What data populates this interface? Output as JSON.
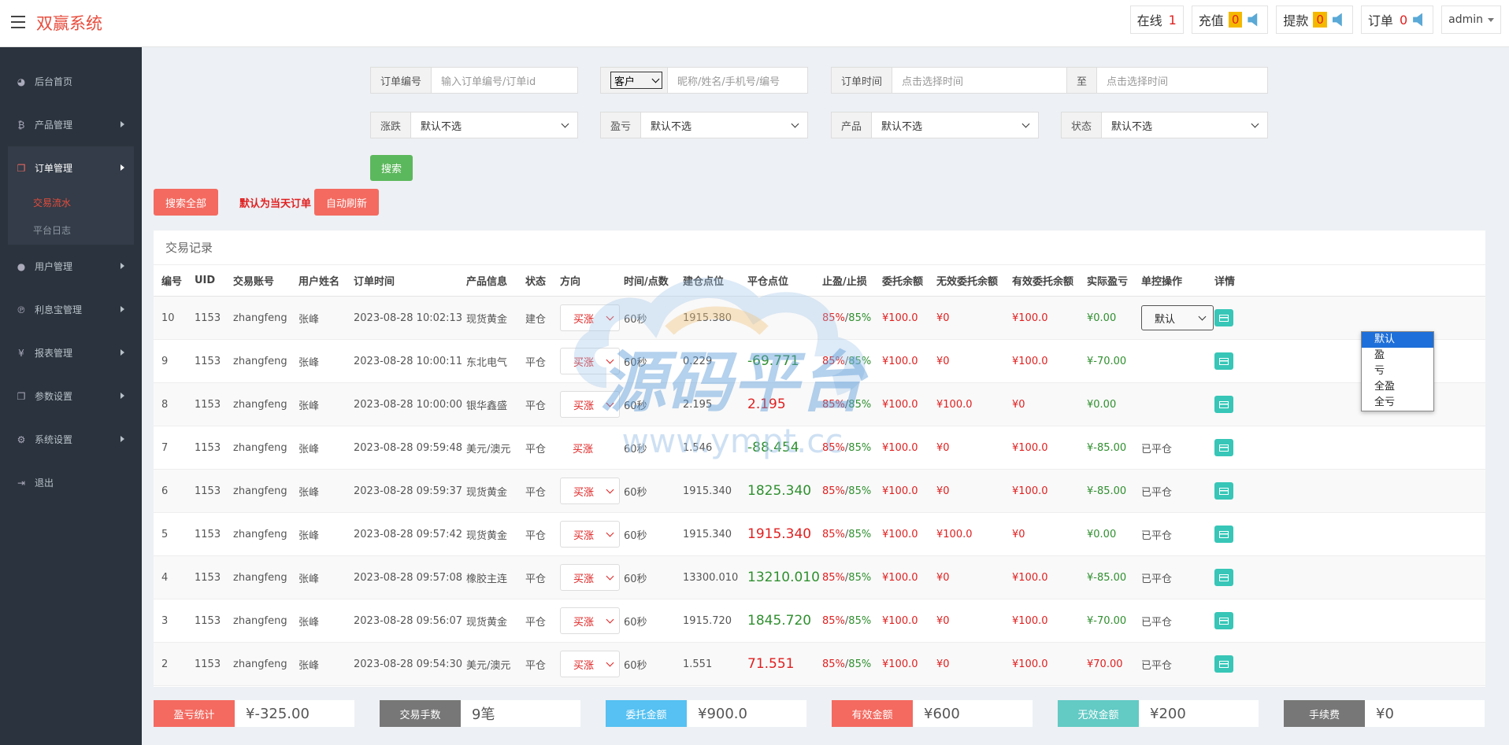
{
  "app": {
    "title": "双赢系统"
  },
  "topbar": {
    "online_label": "在线",
    "online_count": "1",
    "recharge_label": "充值",
    "recharge_count": "0",
    "withdraw_label": "提款",
    "withdraw_count": "0",
    "order_label": "订单",
    "order_count": "0",
    "user": "admin"
  },
  "sidebar": {
    "items": [
      {
        "label": "后台首页",
        "icon": "dashboard-icon"
      },
      {
        "label": "产品管理",
        "icon": "bitcoin-icon"
      },
      {
        "label": "订单管理",
        "icon": "copy-icon"
      },
      {
        "label": "用户管理",
        "icon": "user-icon"
      },
      {
        "label": "利息宝管理",
        "icon": "pinterest-icon"
      },
      {
        "label": "报表管理",
        "icon": "yen-icon"
      },
      {
        "label": "参数设置",
        "icon": "copy-icon"
      },
      {
        "label": "系统设置",
        "icon": "cogs-icon"
      },
      {
        "label": "退出",
        "icon": "sign-out-icon"
      }
    ],
    "sub": [
      {
        "label": "交易流水",
        "active": true
      },
      {
        "label": "平台日志",
        "active": false
      }
    ]
  },
  "filters": {
    "order_no_label": "订单编号",
    "order_no_placeholder": "输入订单编号/订单id",
    "client_select": "客户",
    "client_placeholder": "昵称/姓名/手机号/编号",
    "time_label": "订单时间",
    "time_placeholder": "点击选择时间",
    "to_label": "至",
    "time_placeholder2": "点击选择时间",
    "rise_label": "涨跌",
    "rise_value": "默认不选",
    "pl_label": "盈亏",
    "pl_value": "默认不选",
    "product_label": "产品",
    "product_value": "默认不选",
    "status_label": "状态",
    "status_value": "默认不选",
    "search_btn": "搜索"
  },
  "actions": {
    "search_all": "搜索全部",
    "note": "默认为当天订单",
    "auto_refresh": "自动刷新"
  },
  "table": {
    "title": "交易记录",
    "headers": [
      "编号",
      "UID",
      "交易账号",
      "用户姓名",
      "订单时间",
      "产品信息",
      "状态",
      "方向",
      "时间/点数",
      "建仓点位",
      "平仓点位",
      "止盈/止损",
      "委托余额",
      "无效委托余额",
      "有效委托余额",
      "实际盈亏",
      "单控操作",
      "详情"
    ],
    "rows": [
      {
        "id": "10",
        "uid": "1153",
        "account": "zhangfeng",
        "name": "张峰",
        "time": "2023-08-28 10:02:13",
        "product": "现货黄金",
        "status": "建仓",
        "dir": "买涨",
        "dir_select": true,
        "period": "60秒",
        "open": "1915.380",
        "close": "",
        "close_color": "",
        "tp": "85%",
        "sl": "85%",
        "entrust": "¥100.0",
        "invalid": "¥0",
        "valid": "¥100.0",
        "pl": "¥0.00",
        "pl_color": "grn",
        "op": "默认",
        "op_select": true
      },
      {
        "id": "9",
        "uid": "1153",
        "account": "zhangfeng",
        "name": "张峰",
        "time": "2023-08-28 10:00:11",
        "product": "东北电气",
        "status": "平仓",
        "dir": "买涨",
        "dir_select": true,
        "period": "60秒",
        "open": "0.229",
        "close": "-69.771",
        "close_color": "grn",
        "tp": "85%",
        "sl": "85%",
        "entrust": "¥100.0",
        "invalid": "¥0",
        "valid": "¥100.0",
        "pl": "¥-70.00",
        "pl_color": "grn",
        "op": "",
        "op_select": false
      },
      {
        "id": "8",
        "uid": "1153",
        "account": "zhangfeng",
        "name": "张峰",
        "time": "2023-08-28 10:00:00",
        "product": "银华鑫盛",
        "status": "平仓",
        "dir": "买涨",
        "dir_select": true,
        "period": "60秒",
        "open": "2.195",
        "close": "2.195",
        "close_color": "red",
        "tp": "85%",
        "sl": "85%",
        "entrust": "¥100.0",
        "invalid": "¥100.0",
        "valid": "¥0",
        "pl": "¥0.00",
        "pl_color": "grn",
        "op": "",
        "op_select": false
      },
      {
        "id": "7",
        "uid": "1153",
        "account": "zhangfeng",
        "name": "张峰",
        "time": "2023-08-28 09:59:48",
        "product": "美元/澳元",
        "status": "平仓",
        "dir": "买涨",
        "dir_select": false,
        "period": "60秒",
        "open": "1.546",
        "close": "-88.454",
        "close_color": "grn",
        "tp": "85%",
        "sl": "85%",
        "entrust": "¥100.0",
        "invalid": "¥0",
        "valid": "¥100.0",
        "pl": "¥-85.00",
        "pl_color": "grn",
        "op": "已平仓",
        "op_select": false
      },
      {
        "id": "6",
        "uid": "1153",
        "account": "zhangfeng",
        "name": "张峰",
        "time": "2023-08-28 09:59:37",
        "product": "现货黄金",
        "status": "平仓",
        "dir": "买涨",
        "dir_select": true,
        "period": "60秒",
        "open": "1915.340",
        "close": "1825.340",
        "close_color": "grn",
        "tp": "85%",
        "sl": "85%",
        "entrust": "¥100.0",
        "invalid": "¥0",
        "valid": "¥100.0",
        "pl": "¥-85.00",
        "pl_color": "grn",
        "op": "已平仓",
        "op_select": false
      },
      {
        "id": "5",
        "uid": "1153",
        "account": "zhangfeng",
        "name": "张峰",
        "time": "2023-08-28 09:57:42",
        "product": "现货黄金",
        "status": "平仓",
        "dir": "买涨",
        "dir_select": true,
        "period": "60秒",
        "open": "1915.340",
        "close": "1915.340",
        "close_color": "red",
        "tp": "85%",
        "sl": "85%",
        "entrust": "¥100.0",
        "invalid": "¥100.0",
        "valid": "¥0",
        "pl": "¥0.00",
        "pl_color": "grn",
        "op": "已平仓",
        "op_select": false
      },
      {
        "id": "4",
        "uid": "1153",
        "account": "zhangfeng",
        "name": "张峰",
        "time": "2023-08-28 09:57:08",
        "product": "橡胶主连",
        "status": "平仓",
        "dir": "买涨",
        "dir_select": true,
        "period": "60秒",
        "open": "13300.010",
        "close": "13210.010",
        "close_color": "grn",
        "tp": "85%",
        "sl": "85%",
        "entrust": "¥100.0",
        "invalid": "¥0",
        "valid": "¥100.0",
        "pl": "¥-85.00",
        "pl_color": "grn",
        "op": "已平仓",
        "op_select": false
      },
      {
        "id": "3",
        "uid": "1153",
        "account": "zhangfeng",
        "name": "张峰",
        "time": "2023-08-28 09:56:07",
        "product": "现货黄金",
        "status": "平仓",
        "dir": "买涨",
        "dir_select": true,
        "period": "60秒",
        "open": "1915.720",
        "close": "1845.720",
        "close_color": "grn",
        "tp": "85%",
        "sl": "85%",
        "entrust": "¥100.0",
        "invalid": "¥0",
        "valid": "¥100.0",
        "pl": "¥-70.00",
        "pl_color": "grn",
        "op": "已平仓",
        "op_select": false
      },
      {
        "id": "2",
        "uid": "1153",
        "account": "zhangfeng",
        "name": "张峰",
        "time": "2023-08-28 09:54:30",
        "product": "美元/澳元",
        "status": "平仓",
        "dir": "买涨",
        "dir_select": true,
        "period": "60秒",
        "open": "1.551",
        "close": "71.551",
        "close_color": "red",
        "tp": "85%",
        "sl": "85%",
        "entrust": "¥100.0",
        "invalid": "¥0",
        "valid": "¥100.0",
        "pl": "¥70.00",
        "pl_color": "red",
        "op": "已平仓",
        "op_select": false
      }
    ]
  },
  "dropdown": {
    "options": [
      "默认",
      "盈",
      "亏",
      "全盈",
      "全亏"
    ],
    "selected": "默认"
  },
  "summary": [
    {
      "label": "盈亏统计",
      "value": "¥-325.00",
      "color": "#f46a60"
    },
    {
      "label": "交易手数",
      "value": "9笔",
      "color": "#777777"
    },
    {
      "label": "委托金额",
      "value": "¥900.0",
      "color": "#56c1f2"
    },
    {
      "label": "有效金额",
      "value": "¥600",
      "color": "#f46a60"
    },
    {
      "label": "无效金额",
      "value": "¥200",
      "color": "#63cac4"
    },
    {
      "label": "手续费",
      "value": "¥0",
      "color": "#777777"
    }
  ],
  "watermark": {
    "text": "源码平台",
    "url": "www.ympt.cc"
  }
}
